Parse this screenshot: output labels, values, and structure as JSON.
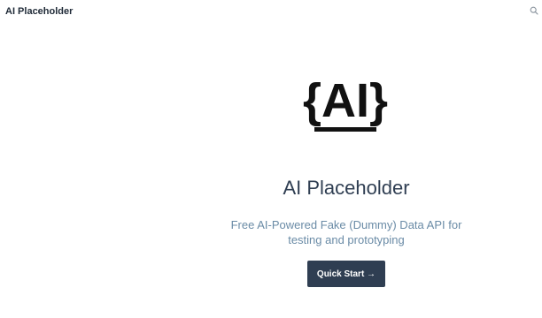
{
  "header": {
    "brand": "AI Placeholder",
    "search_icon": "search-icon"
  },
  "hero": {
    "logo_text": "{AI}",
    "title": "AI Placeholder",
    "subtitle": "Free AI-Powered Fake (Dummy) Data API for testing and prototyping",
    "cta_label": "Quick Start →"
  },
  "colors": {
    "text_dark": "#1f2a37",
    "title": "#2f3e52",
    "subtitle": "#6a8ba6",
    "button_bg": "#2f3e52",
    "button_text": "#ffffff",
    "background": "#ffffff"
  }
}
